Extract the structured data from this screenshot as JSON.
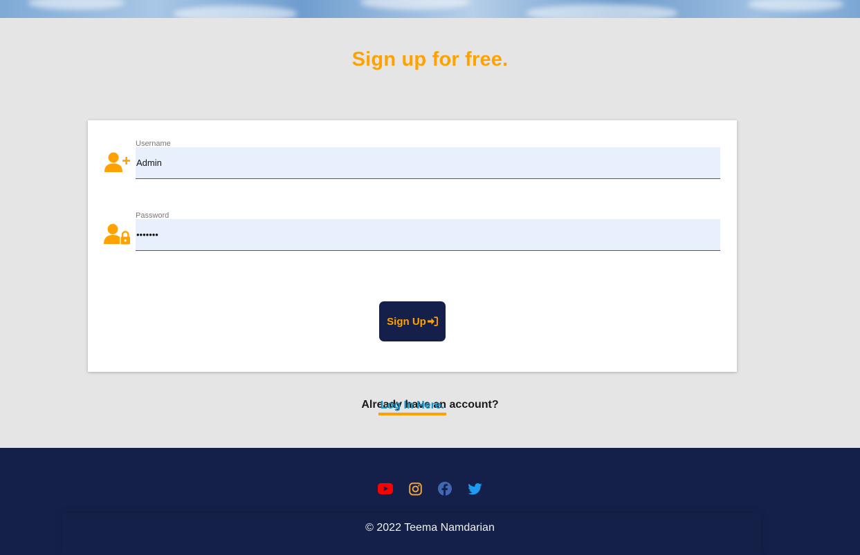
{
  "form": {
    "title": "Sign up for free.",
    "username": {
      "label": "Username",
      "value": "Admin"
    },
    "password": {
      "label": "Password",
      "value": "•••••••"
    },
    "submit_label": "Sign Up"
  },
  "login_prompt": {
    "question": "Already have an account?",
    "link_text": "Log In Here."
  },
  "footer": {
    "social": [
      {
        "name": "youtube",
        "color": "#ff0000"
      },
      {
        "name": "instagram",
        "color": "#e8a33d"
      },
      {
        "name": "facebook",
        "color": "#4267b2"
      },
      {
        "name": "twitter",
        "color": "#1d9bf0"
      }
    ],
    "copyright": "© 2022 Teema Namdarian"
  },
  "colors": {
    "accent": "#ffa200",
    "navy": "#15204a",
    "link": "#1792c7",
    "input_bg": "#e8f0fe",
    "page_bg": "#e5e5e5"
  }
}
